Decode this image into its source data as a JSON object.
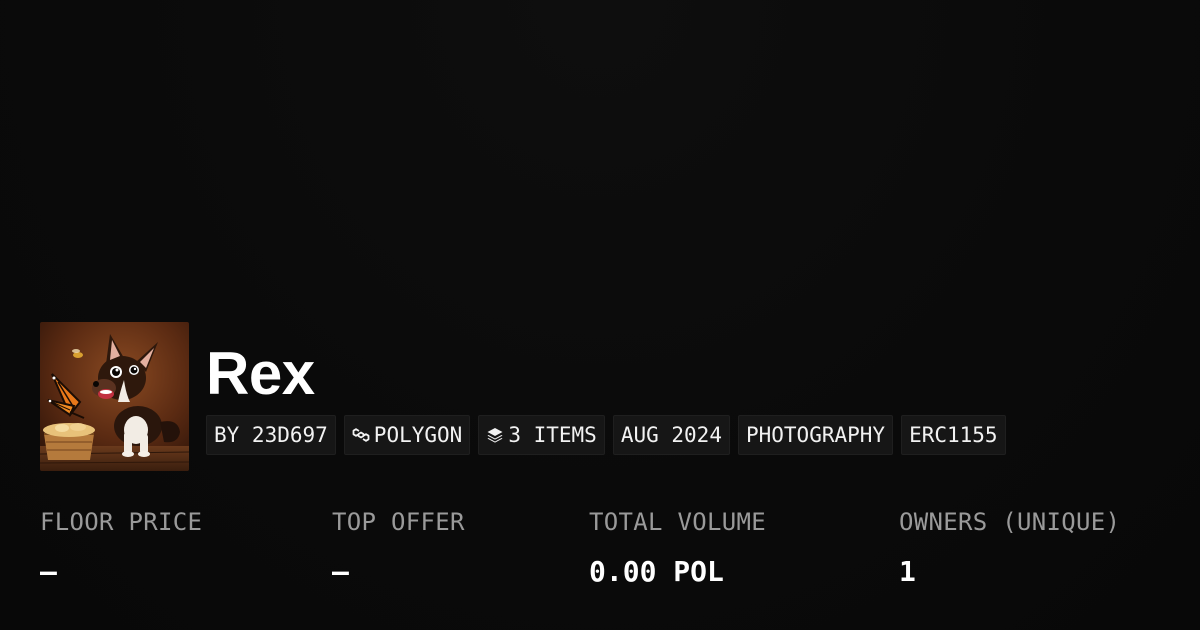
{
  "collection": {
    "title": "Rex",
    "thumbnail_alt": "Chihuahua puppy with a monarch butterfly"
  },
  "tags": [
    {
      "label": "BY 23D697",
      "icon": ""
    },
    {
      "label": "POLYGON",
      "icon": "polygon-icon"
    },
    {
      "label": "3 ITEMS",
      "icon": "layers-icon"
    },
    {
      "label": "AUG 2024",
      "icon": ""
    },
    {
      "label": "PHOTOGRAPHY",
      "icon": ""
    },
    {
      "label": "ERC1155",
      "icon": ""
    }
  ],
  "stats": [
    {
      "label": "FLOOR PRICE",
      "value": "–"
    },
    {
      "label": "TOP OFFER",
      "value": "–"
    },
    {
      "label": "TOTAL VOLUME",
      "value": "0.00 POL"
    },
    {
      "label": "OWNERS (UNIQUE)",
      "value": "1"
    }
  ],
  "colors": {
    "background": "#0b0b0b",
    "tag_background": "#161616",
    "label_text": "#9a9a9a",
    "value_text": "#ffffff"
  }
}
